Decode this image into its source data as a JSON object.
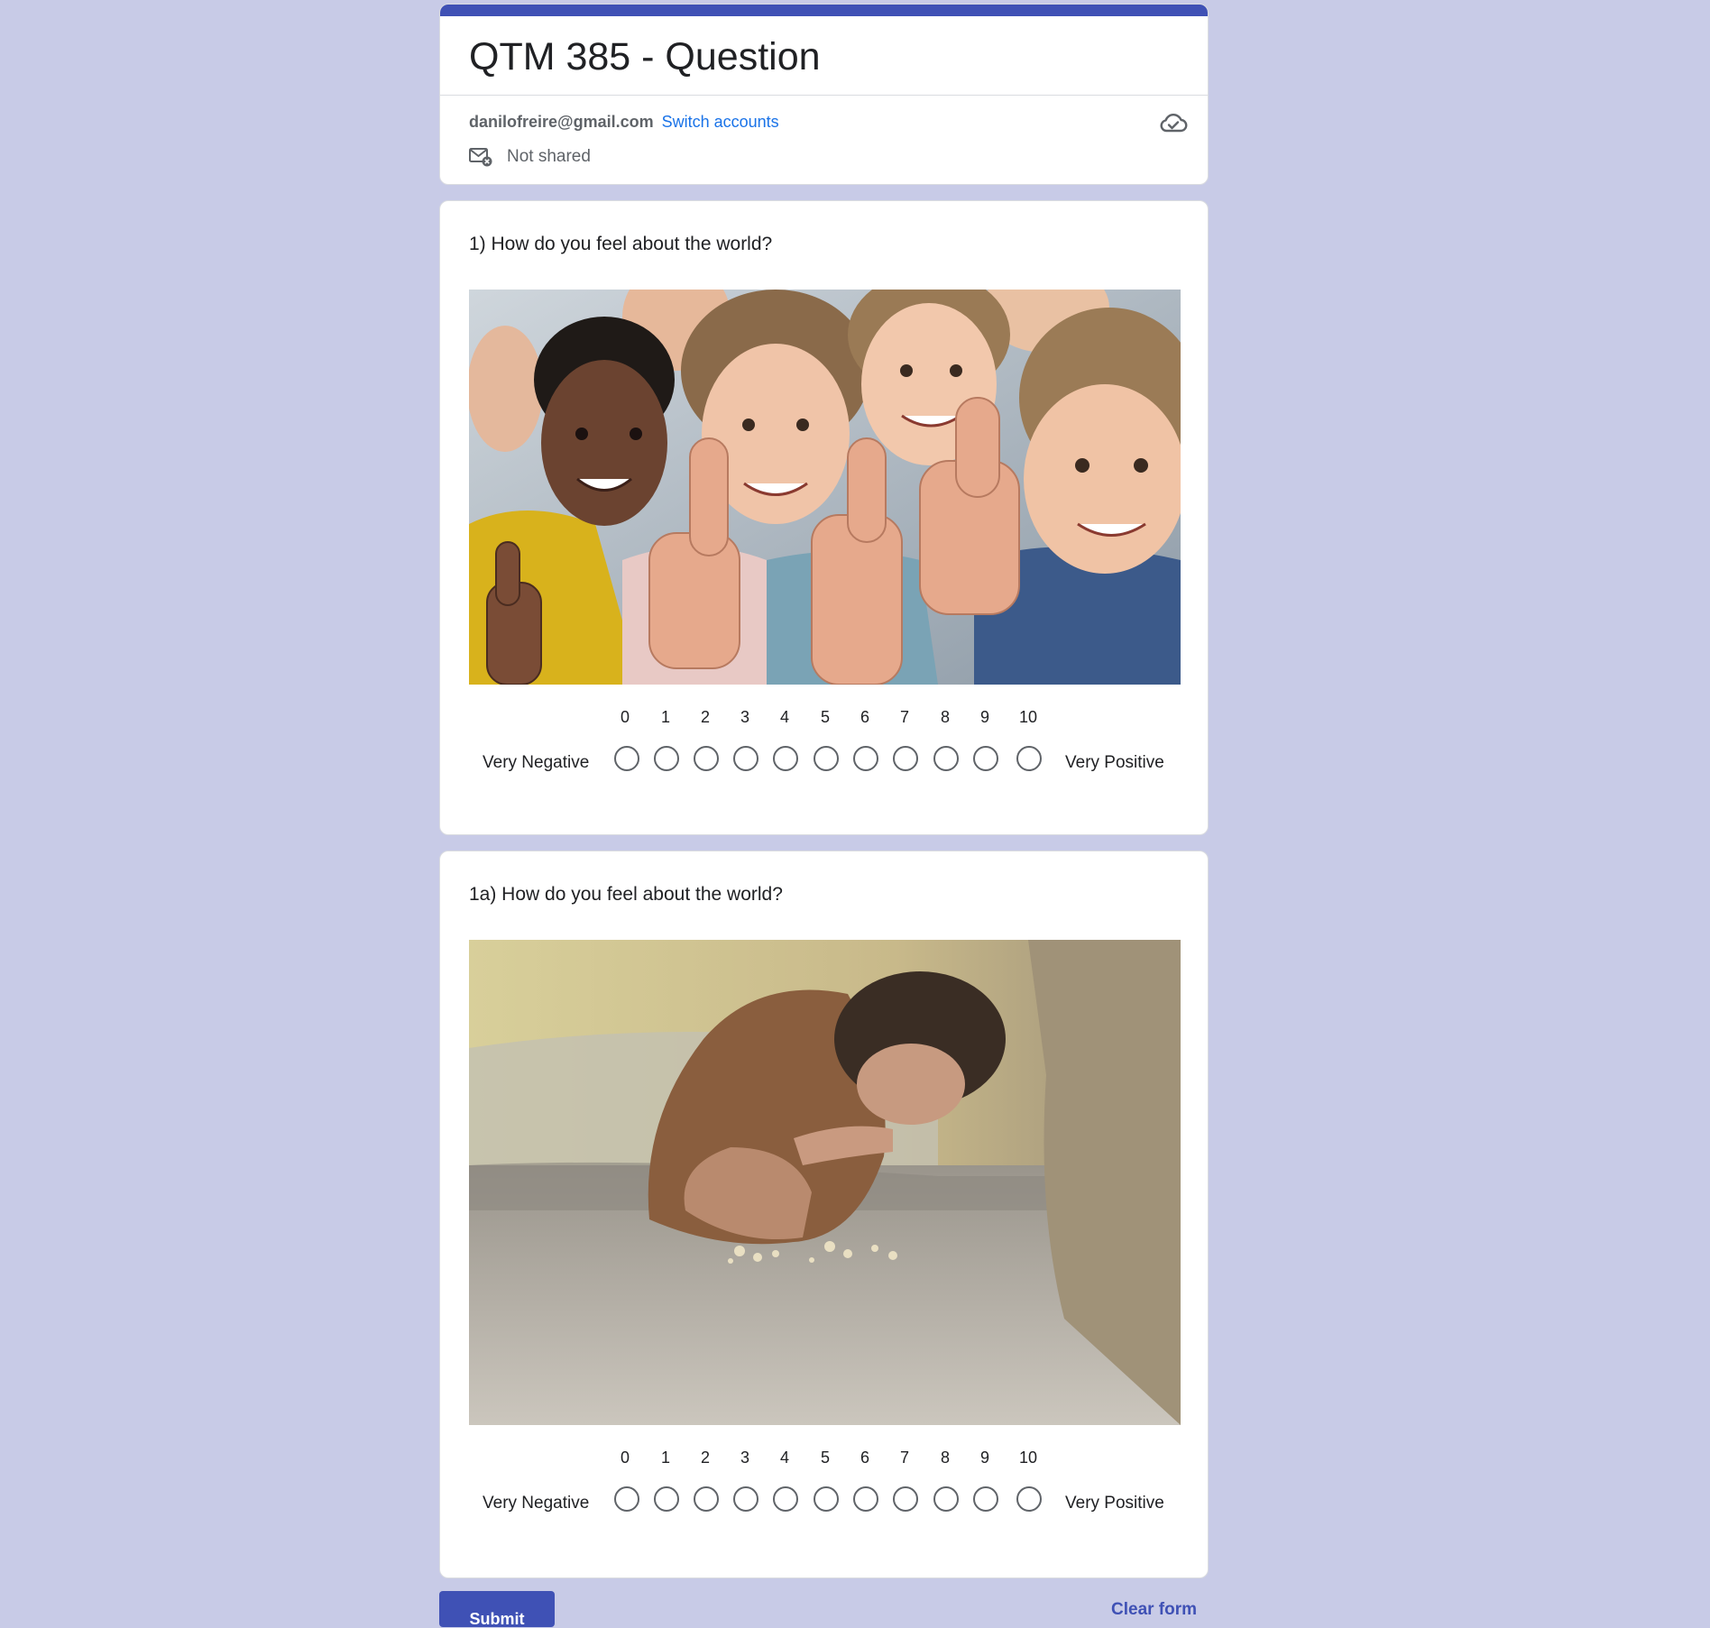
{
  "form": {
    "title": "QTM 385 - Question",
    "account_email": "danilofreire@gmail.com",
    "switch_accounts": "Switch accounts",
    "not_shared": "Not shared",
    "accent_color": "#3f51b5",
    "background_color": "#c8cbe7"
  },
  "questions": [
    {
      "title": "1) How do you feel about the world?",
      "image_icon": "photo-of-smiling-children-thumbs-up",
      "scale": [
        "0",
        "1",
        "2",
        "3",
        "4",
        "5",
        "6",
        "7",
        "8",
        "9",
        "10"
      ],
      "low_label": "Very Negative",
      "high_label": "Very Positive",
      "selected": null
    },
    {
      "title": "1a) How do you feel about the world?",
      "image_icon": "photo-of-child-eating-crumbs-from-floor",
      "scale": [
        "0",
        "1",
        "2",
        "3",
        "4",
        "5",
        "6",
        "7",
        "8",
        "9",
        "10"
      ],
      "low_label": "Very Negative",
      "high_label": "Very Positive",
      "selected": null
    }
  ],
  "footer": {
    "submit_label": "Submit",
    "clear_label": "Clear form"
  }
}
